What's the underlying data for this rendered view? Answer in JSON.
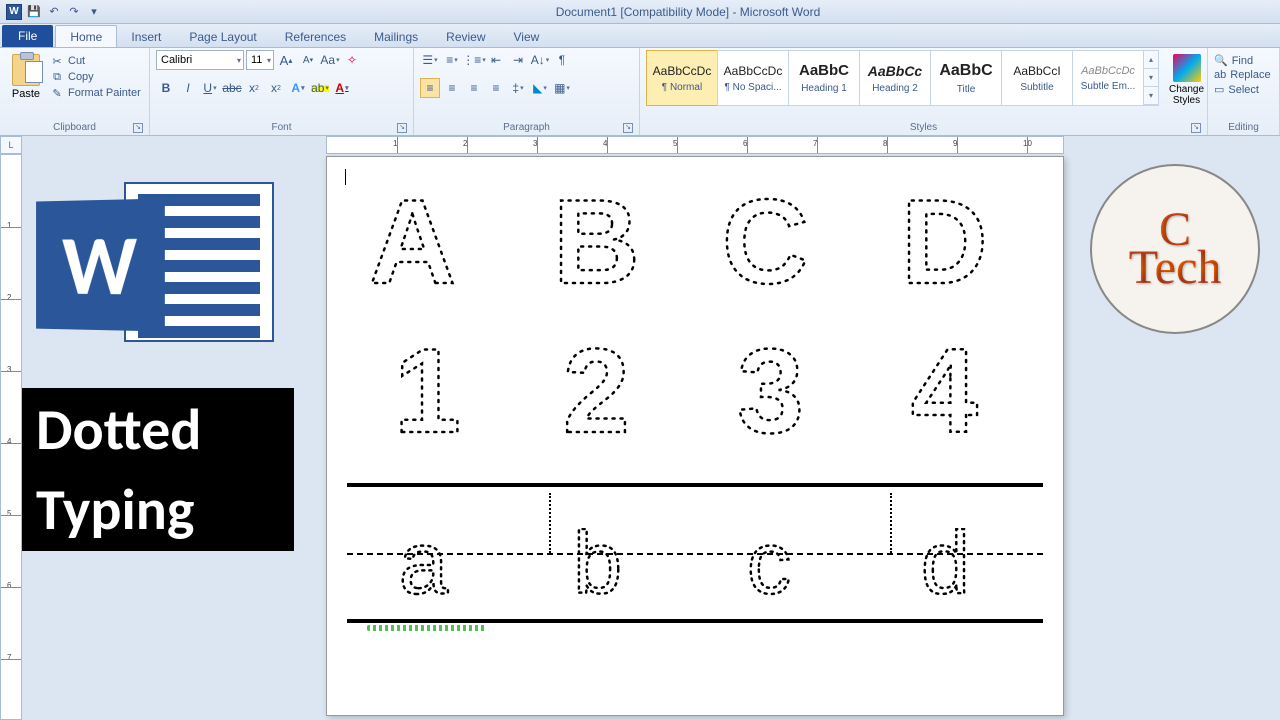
{
  "titlebar": {
    "title": "Document1 [Compatibility Mode] - Microsoft Word"
  },
  "tabs": {
    "file": "File",
    "home": "Home",
    "insert": "Insert",
    "page_layout": "Page Layout",
    "references": "References",
    "mailings": "Mailings",
    "review": "Review",
    "view": "View"
  },
  "clipboard": {
    "paste": "Paste",
    "cut": "Cut",
    "copy": "Copy",
    "format_painter": "Format Painter",
    "label": "Clipboard"
  },
  "font": {
    "name": "Calibri",
    "size": "11",
    "label": "Font"
  },
  "paragraph": {
    "label": "Paragraph"
  },
  "styles": {
    "label": "Styles",
    "change": "Change Styles",
    "items": [
      {
        "preview": "AaBbCcDc",
        "name": "¶ Normal"
      },
      {
        "preview": "AaBbCcDc",
        "name": "¶ No Spaci..."
      },
      {
        "preview": "AaBbC",
        "name": "Heading 1"
      },
      {
        "preview": "AaBbCc",
        "name": "Heading 2"
      },
      {
        "preview": "AaBbC",
        "name": "Title"
      },
      {
        "preview": "AaBbCcI",
        "name": "Subtitle"
      },
      {
        "preview": "AaBbCcDc",
        "name": "Subtle Em..."
      }
    ]
  },
  "editing": {
    "find": "Find",
    "replace": "Replace",
    "select": "Select",
    "label": "Editing"
  },
  "ruler_corner": "L",
  "document": {
    "row1": [
      "A",
      "B",
      "C",
      "D"
    ],
    "row2": [
      "1",
      "2",
      "3",
      "4"
    ],
    "row3": [
      "a",
      "b",
      "c",
      "d"
    ]
  },
  "overlay": {
    "dotted": "Dotted",
    "typing": "Typing",
    "word_letter": "W",
    "ctech_line1": "C",
    "ctech_line2": "Tech"
  }
}
